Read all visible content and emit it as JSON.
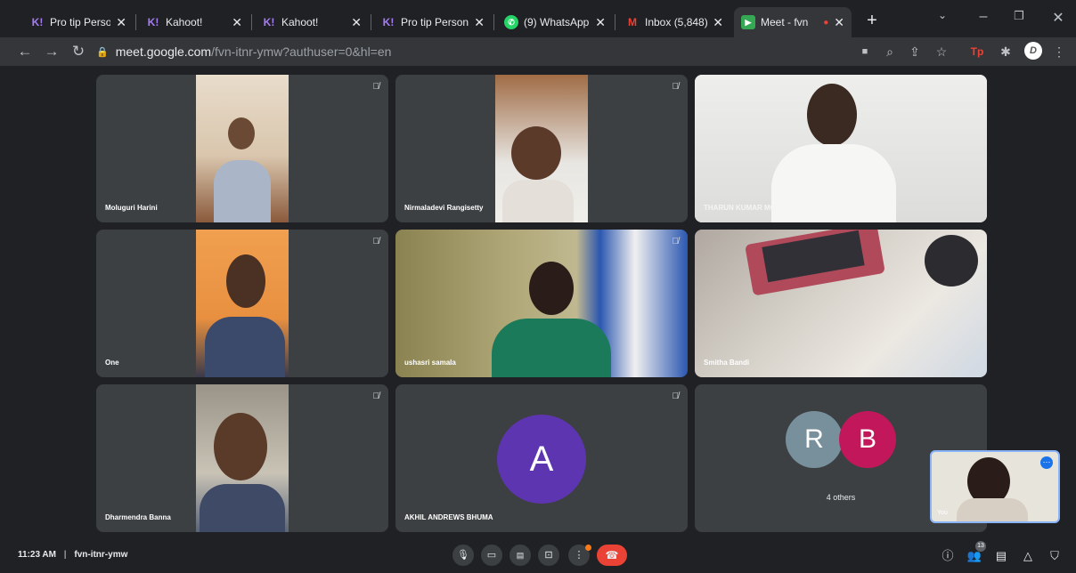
{
  "browser": {
    "tabs": [
      {
        "title": "Pro tip Persona",
        "favicon": "kahoot-icon"
      },
      {
        "title": "Kahoot!",
        "favicon": "kahoot-icon"
      },
      {
        "title": "Kahoot!",
        "favicon": "kahoot-icon"
      },
      {
        "title": "Pro tip Persona",
        "favicon": "kahoot-icon"
      },
      {
        "title": "(9) WhatsApp",
        "favicon": "whatsapp-icon"
      },
      {
        "title": "Inbox (5,848) -",
        "favicon": "gmail-icon"
      },
      {
        "title": "Meet - fvn",
        "favicon": "meet-icon",
        "active": true
      }
    ],
    "url_host": "meet.google.com",
    "url_path": "/fvn-itnr-ymw?authuser=0&hl=en",
    "profile_initial": "D"
  },
  "meeting": {
    "time": "11:23 AM",
    "separator": "|",
    "code": "fvn-itnr-ymw",
    "participant_count": "13"
  },
  "tiles": [
    {
      "name": "Moluguri Harini",
      "muted": true
    },
    {
      "name": "Nirmaladevi Rangisetty",
      "muted": true
    },
    {
      "name": "THARUN KUMAR MOTTU",
      "muted": false
    },
    {
      "name": "One",
      "muted": true
    },
    {
      "name": "ushasri samala",
      "muted": true
    },
    {
      "name": "Smitha Bandi",
      "muted": false
    },
    {
      "name": "Dharmendra Banna",
      "muted": true
    },
    {
      "name": "AKHIL ANDREWS BHUMA",
      "muted": true,
      "avatar_letter": "A",
      "avatar_color": "#5e35b1"
    },
    {
      "name": "4 others",
      "avatars": [
        {
          "letter": "R",
          "color": "#78909c"
        },
        {
          "letter": "B",
          "color": "#c2185b"
        }
      ]
    }
  ],
  "self_view": {
    "label": "You"
  },
  "colors": {
    "end_call": "#ea4335",
    "background": "#202124",
    "tile": "#3c4043"
  }
}
